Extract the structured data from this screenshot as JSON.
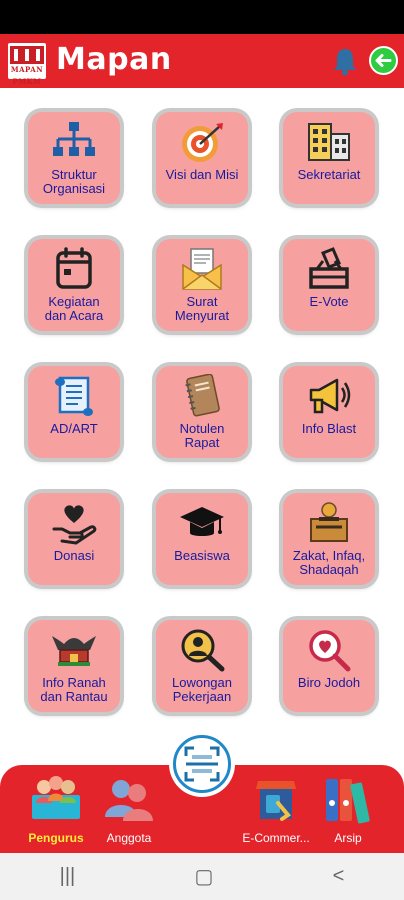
{
  "app_bar": {
    "title": "Mapan",
    "logo_text": "MAPAN PMKM",
    "bell_icon": "bell-icon",
    "back_icon": "arrow-left-circle-icon"
  },
  "menu": [
    {
      "id": "struktur-organisasi",
      "label": "Struktur\nOrganisasi",
      "icon": "org-chart-icon"
    },
    {
      "id": "visi-dan-misi",
      "label": "Visi dan Misi",
      "icon": "target-icon"
    },
    {
      "id": "sekretariat",
      "label": "Sekretariat",
      "icon": "building-icon"
    },
    {
      "id": "kegiatan-dan-acara",
      "label": "Kegiatan\ndan Acara",
      "icon": "calendar-icon"
    },
    {
      "id": "surat-menyurat",
      "label": "Surat\nMenyurat",
      "icon": "envelope-icon"
    },
    {
      "id": "e-vote",
      "label": "E-Vote",
      "icon": "ballot-box-icon"
    },
    {
      "id": "ad-art",
      "label": "AD/ART",
      "icon": "scroll-icon"
    },
    {
      "id": "notulen-rapat",
      "label": "Notulen\nRapat",
      "icon": "notebook-icon"
    },
    {
      "id": "info-blast",
      "label": "Info Blast",
      "icon": "megaphone-icon"
    },
    {
      "id": "donasi",
      "label": "Donasi",
      "icon": "heart-hand-icon"
    },
    {
      "id": "beasiswa",
      "label": "Beasiswa",
      "icon": "graduation-cap-icon"
    },
    {
      "id": "zakat",
      "label": "Zakat, Infaq,\nShadaqah",
      "icon": "zakat-box-icon"
    },
    {
      "id": "info-ranah-dan-rantau",
      "label": "Info Ranah\ndan Rantau",
      "icon": "rumah-gadang-icon"
    },
    {
      "id": "lowongan-pekerjaan",
      "label": "Lowongan\nPekerjaan",
      "icon": "job-search-icon"
    },
    {
      "id": "biro-jodoh",
      "label": "Biro Jodoh",
      "icon": "heart-search-icon"
    }
  ],
  "bottom_nav": [
    {
      "id": "pengurus",
      "label": "Pengurus",
      "icon": "committee-icon",
      "active": true
    },
    {
      "id": "anggota",
      "label": "Anggota",
      "icon": "members-icon",
      "active": false
    },
    {
      "id": "e-commerce",
      "label": "E-Commer...",
      "icon": "shop-icon",
      "active": false
    },
    {
      "id": "arsip",
      "label": "Arsip",
      "icon": "binders-icon",
      "active": false
    }
  ],
  "scan": {
    "icon": "qr-scan-icon"
  },
  "colors": {
    "brand_red": "#e3242b",
    "tile_bg": "#f6a0a0",
    "label_blue": "#1a1a9e",
    "active_label": "#ffeb3b"
  }
}
